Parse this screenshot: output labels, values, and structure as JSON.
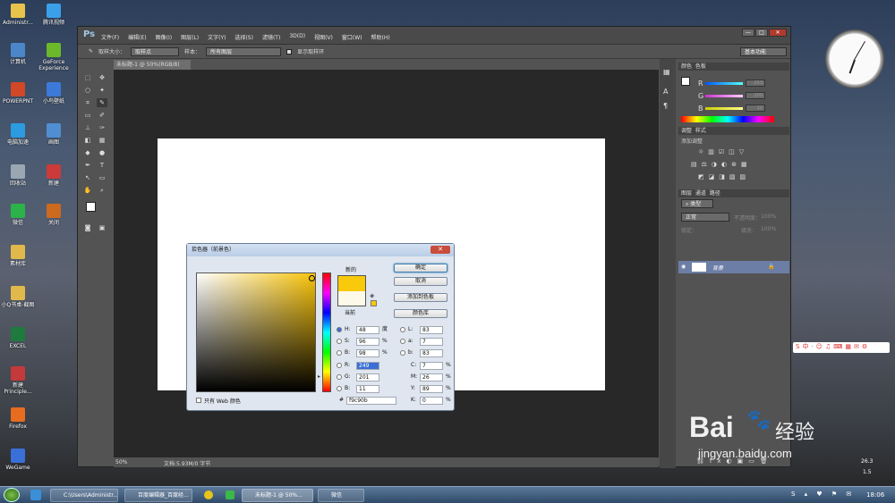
{
  "desktop": {
    "icons": [
      {
        "label": "Administr...",
        "color": "#e8c24a"
      },
      {
        "label": "腾讯视频",
        "color": "#3aa0e8"
      },
      {
        "label": "计算机",
        "color": "#4a86c9"
      },
      {
        "label": "GeForce Experience",
        "color": "#6bb82a"
      },
      {
        "label": "POWERPNT",
        "color": "#d24726"
      },
      {
        "label": "小鸟壁纸",
        "color": "#3b7ad9"
      },
      {
        "label": "电脑加速",
        "color": "#2c9be0"
      },
      {
        "label": "画图",
        "color": "#4f8fd1"
      },
      {
        "label": "回收站",
        "color": "#9aa7b3"
      },
      {
        "label": "新建",
        "color": "#cc3a3a"
      },
      {
        "label": "微信",
        "color": "#2bb34a"
      },
      {
        "label": "关闭",
        "color": "#cc6a20"
      },
      {
        "label": "素材库",
        "color": "#e0b84c"
      },
      {
        "label": "小Q书桌-截图",
        "color": "#e0b84c"
      },
      {
        "label": "EXCEL",
        "color": "#1f7a3e"
      },
      {
        "label": "新建 Principle...",
        "color": "#c43a3a"
      },
      {
        "label": "Firefox",
        "color": "#e66c1f"
      },
      {
        "label": "WeGame",
        "color": "#3a6fd8"
      }
    ]
  },
  "photoshop": {
    "logo": "Ps",
    "menu": [
      "文件(F)",
      "编辑(E)",
      "图像(I)",
      "图层(L)",
      "文字(Y)",
      "选择(S)",
      "滤镜(T)",
      "3D(D)",
      "视图(V)",
      "窗口(W)",
      "帮助(H)"
    ],
    "window_controls": [
      "—",
      "□",
      "✕"
    ],
    "options": {
      "sample_size_label": "取样大小：",
      "sample_size_value": "取样点",
      "sample_label": "样本：",
      "sample_value": "所有图层",
      "show_ring": "显示取样环",
      "workspace": "基本功能"
    },
    "doc_tab": "未标题-1 @ 50%(RGB/8)",
    "status": {
      "zoom": "50%",
      "doc": "文档:5.93M/0 字节"
    },
    "panels": {
      "color": {
        "tabs": [
          "颜色",
          "色板"
        ],
        "r": "R",
        "g": "G",
        "b": "B",
        "r_val": "253",
        "g_val": "200",
        "b_val": "12"
      },
      "adjust": {
        "tabs": [
          "调整",
          "样式"
        ],
        "label": "添加调整"
      },
      "layers": {
        "tabs": [
          "图层",
          "通道",
          "路径"
        ],
        "kind": "类型",
        "blend": "正常",
        "opacity_label": "不透明度：",
        "opacity": "100%",
        "lock_label": "锁定：",
        "fill_label": "填充：",
        "fill": "100%",
        "layer_name": "背景"
      }
    }
  },
  "picker": {
    "title": "拾色器（前景色）",
    "new_label": "新的",
    "current_label": "当前",
    "new_color": "#f9c90b",
    "current_color": "#fdf9e8",
    "buttons": {
      "ok": "确定",
      "cancel": "取消",
      "add_swatch": "添加到色板",
      "libraries": "颜色库"
    },
    "fields": {
      "H": "48",
      "S": "96",
      "B": "98",
      "R": "249",
      "G": "201",
      "Bl": "11",
      "L": "83",
      "a": "7",
      "b": "83",
      "C": "7",
      "M": "26",
      "Y": "89",
      "K": "0"
    },
    "units": {
      "deg": "度",
      "pct": "%"
    },
    "hex_label": "#",
    "hex": "f9c90b",
    "web_only": "只有 Web 颜色"
  },
  "taskbar": {
    "items": [
      "C:\\Users\\Administr...",
      "百度编辑器_百度经...",
      "未标题-1 @ 50%...",
      "微信"
    ],
    "time": "18:06"
  },
  "clock": {
    "temp": "26.3",
    "num": "1.5"
  },
  "watermark": {
    "brand": "Bai",
    "brand2": "经验",
    "url": "jingyan.baidu.com"
  }
}
